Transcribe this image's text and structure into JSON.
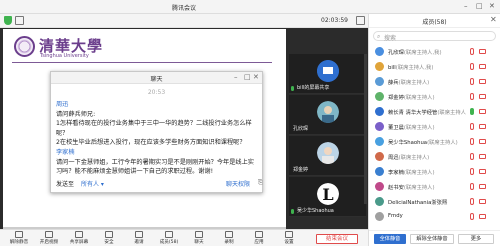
{
  "window": {
    "title": "腾讯会议",
    "timer": "02:03:59"
  },
  "slide": {
    "logo_cn": "清華大學",
    "logo_en": "Tsinghua University"
  },
  "chat": {
    "title": "聊天",
    "time": "20:53",
    "messages": [
      {
        "sender": "周迅",
        "lines": [
          "请问薛兵师兄:",
          "1怎样看待现在的投行业务集中于三中一华的趋势？二线投行业务怎么样呢？",
          "2在校生毕业后想进入投行，现在应该多学些财务方面知识和课程呢？"
        ]
      },
      {
        "sender": "李家楠",
        "lines": [
          "请问一下金慧师姐，工行今年的暑期实习是不是刚刚开始？今年是线上实习吗？能不能麻烦金慧师姐讲一下自己的求职过程。谢谢!"
        ]
      }
    ],
    "send_to_label": "发送至",
    "send_to_value": "所有人",
    "permission": "聊天权限",
    "file_icon": "file-icon"
  },
  "tiles": [
    {
      "name": "bill的屏幕共享"
    },
    {
      "name": "孔欣琛"
    },
    {
      "name": "郑金婷"
    },
    {
      "name": "吴少华Shaohua"
    }
  ],
  "bottombar": {
    "items": [
      "解除静音",
      "开启视频",
      "共享屏幕",
      "安全",
      "邀请",
      "成员(58)",
      "聊天",
      "录制",
      "应用",
      "设置"
    ],
    "end": "结束会议"
  },
  "panel": {
    "title": "成员(58)",
    "search": "搜索",
    "members": [
      {
        "name": "孔欣琛",
        "role": "(联席主持人,我)",
        "color": "#4a8fe0"
      },
      {
        "name": "bill",
        "role": "(联席主持人,我)",
        "color": "#e0a43a"
      },
      {
        "name": "薛兵",
        "role": "(联席主持人)",
        "color": "#5a9bd6"
      },
      {
        "name": "郑金婷",
        "role": "(联席主持人)",
        "color": "#5fb36a"
      },
      {
        "name": "赖长青 清华大学经管",
        "role": "(联席主持人)",
        "color": "#2f6fcf"
      },
      {
        "name": "董卫晨",
        "role": "(联席主持人)",
        "color": "#7b60c9"
      },
      {
        "name": "吴少华Shaohua",
        "role": "(联席主持人)",
        "color": "#48a0e0"
      },
      {
        "name": "周迅",
        "role": "(联席主持人)",
        "color": "#d06a4a"
      },
      {
        "name": "李家楠",
        "role": "(联席主持人)",
        "color": "#3a7fd0"
      },
      {
        "name": "赵书安",
        "role": "(联席主持人)",
        "color": "#c04a8a"
      },
      {
        "name": "DelicialNathania浙张熙",
        "role": "",
        "color": "#4a9a8a"
      },
      {
        "name": "Fmdy",
        "role": "",
        "color": "#a0a0a0"
      }
    ],
    "footer": {
      "mute_all": "全体静音",
      "unmute_all": "解除全体静音",
      "more": "更多"
    }
  }
}
